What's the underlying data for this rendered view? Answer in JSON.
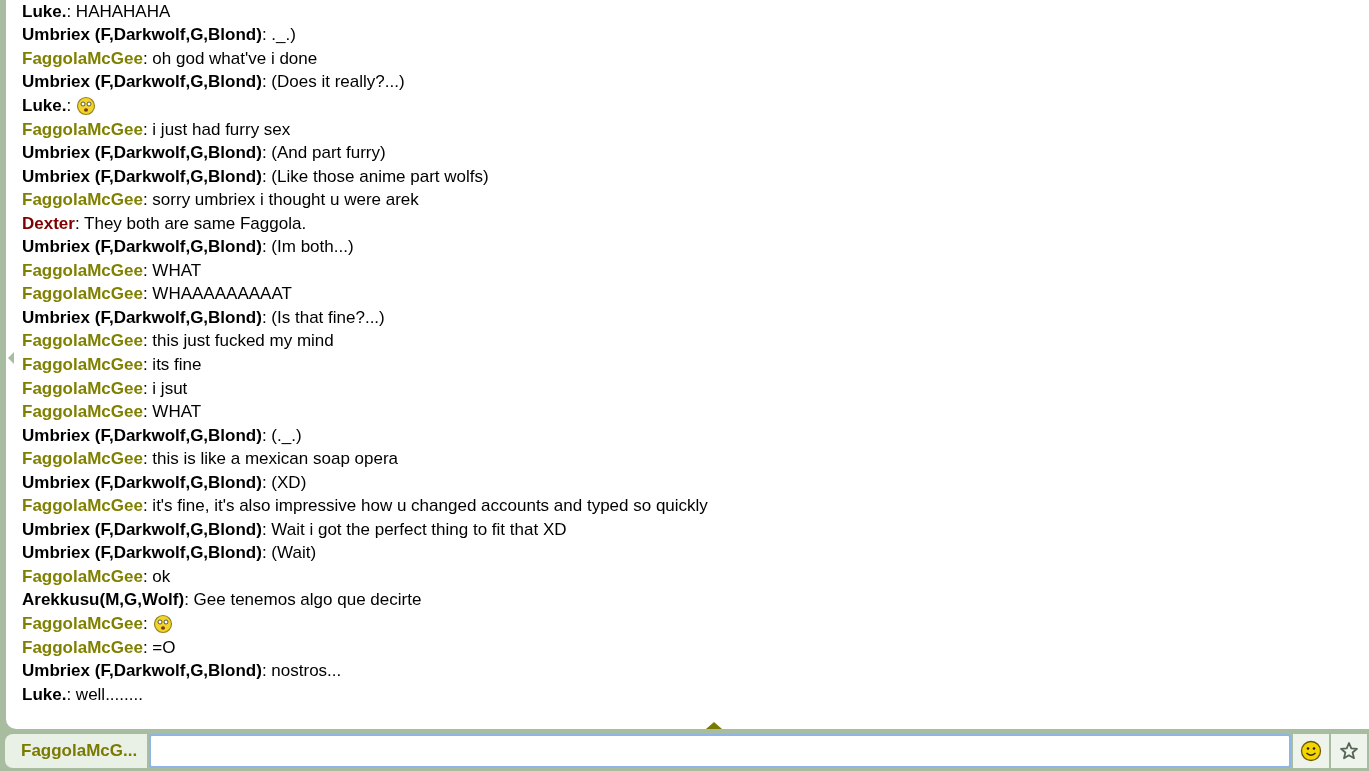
{
  "messages": [
    {
      "user": "Luke.",
      "color": "#000000",
      "kind": "text",
      "text": ": HAHAHAHA"
    },
    {
      "user": "Umbriex (F,Darkwolf,G,Blond)",
      "color": "#000000",
      "kind": "text",
      "text": ": ._.)"
    },
    {
      "user": "FaggolaMcGee",
      "color": "#808000",
      "kind": "text",
      "text": ": oh god what've i done"
    },
    {
      "user": "Umbriex (F,Darkwolf,G,Blond)",
      "color": "#000000",
      "kind": "text",
      "text": ": (Does it really?...)"
    },
    {
      "user": "Luke.",
      "color": "#000000",
      "kind": "emoji",
      "text": ":"
    },
    {
      "user": "FaggolaMcGee",
      "color": "#808000",
      "kind": "text",
      "text": ": i just had furry sex"
    },
    {
      "user": "Umbriex (F,Darkwolf,G,Blond)",
      "color": "#000000",
      "kind": "text",
      "text": ": (And part furry)"
    },
    {
      "user": "Umbriex (F,Darkwolf,G,Blond)",
      "color": "#000000",
      "kind": "text",
      "text": ": (Like those anime part wolfs)"
    },
    {
      "user": "FaggolaMcGee",
      "color": "#808000",
      "kind": "text",
      "text": ": sorry umbriex i thought u were arek"
    },
    {
      "user": "Dexter",
      "color": "#800000",
      "kind": "text",
      "text": ": They both are same Faggola."
    },
    {
      "user": "Umbriex (F,Darkwolf,G,Blond)",
      "color": "#000000",
      "kind": "text",
      "text": ": (Im both...)"
    },
    {
      "user": "FaggolaMcGee",
      "color": "#808000",
      "kind": "text",
      "text": ": WHAT"
    },
    {
      "user": "FaggolaMcGee",
      "color": "#808000",
      "kind": "text",
      "text": ": WHAAAAAAAAAT"
    },
    {
      "user": "Umbriex (F,Darkwolf,G,Blond)",
      "color": "#000000",
      "kind": "text",
      "text": ": (Is that fine?...)"
    },
    {
      "user": "FaggolaMcGee",
      "color": "#808000",
      "kind": "text",
      "text": ": this just fucked my mind"
    },
    {
      "user": "FaggolaMcGee",
      "color": "#808000",
      "kind": "text",
      "text": ": its fine"
    },
    {
      "user": "FaggolaMcGee",
      "color": "#808000",
      "kind": "text",
      "text": ": i jsut"
    },
    {
      "user": "FaggolaMcGee",
      "color": "#808000",
      "kind": "text",
      "text": ": WHAT"
    },
    {
      "user": "Umbriex (F,Darkwolf,G,Blond)",
      "color": "#000000",
      "kind": "text",
      "text": ": (._.)"
    },
    {
      "user": "FaggolaMcGee",
      "color": "#808000",
      "kind": "text",
      "text": ": this is like a mexican soap opera"
    },
    {
      "user": "Umbriex (F,Darkwolf,G,Blond)",
      "color": "#000000",
      "kind": "text",
      "text": ": (XD)"
    },
    {
      "user": "FaggolaMcGee",
      "color": "#808000",
      "kind": "text",
      "text": ": it's fine, it's also impressive how u changed accounts and typed so quickly"
    },
    {
      "user": "Umbriex (F,Darkwolf,G,Blond)",
      "color": "#000000",
      "kind": "text",
      "text": ": Wait i got the perfect thing to fit that XD"
    },
    {
      "user": "Umbriex (F,Darkwolf,G,Blond)",
      "color": "#000000",
      "kind": "text",
      "text": ": (Wait)"
    },
    {
      "user": "FaggolaMcGee",
      "color": "#808000",
      "kind": "text",
      "text": ": ok"
    },
    {
      "user": "Arekkusu(M,G,Wolf)",
      "color": "#000000",
      "kind": "text",
      "text": ": Gee tenemos algo que decirte"
    },
    {
      "user": "FaggolaMcGee",
      "color": "#808000",
      "kind": "emoji",
      "text": ":"
    },
    {
      "user": "FaggolaMcGee",
      "color": "#808000",
      "kind": "text",
      "text": ": =O"
    },
    {
      "user": "Umbriex (F,Darkwolf,G,Blond)",
      "color": "#000000",
      "kind": "text",
      "text": ": nostros..."
    },
    {
      "user": "Luke.",
      "color": "#000000",
      "kind": "text",
      "text": ": well........"
    }
  ],
  "composer": {
    "name": "FaggolaMcG..."
  }
}
